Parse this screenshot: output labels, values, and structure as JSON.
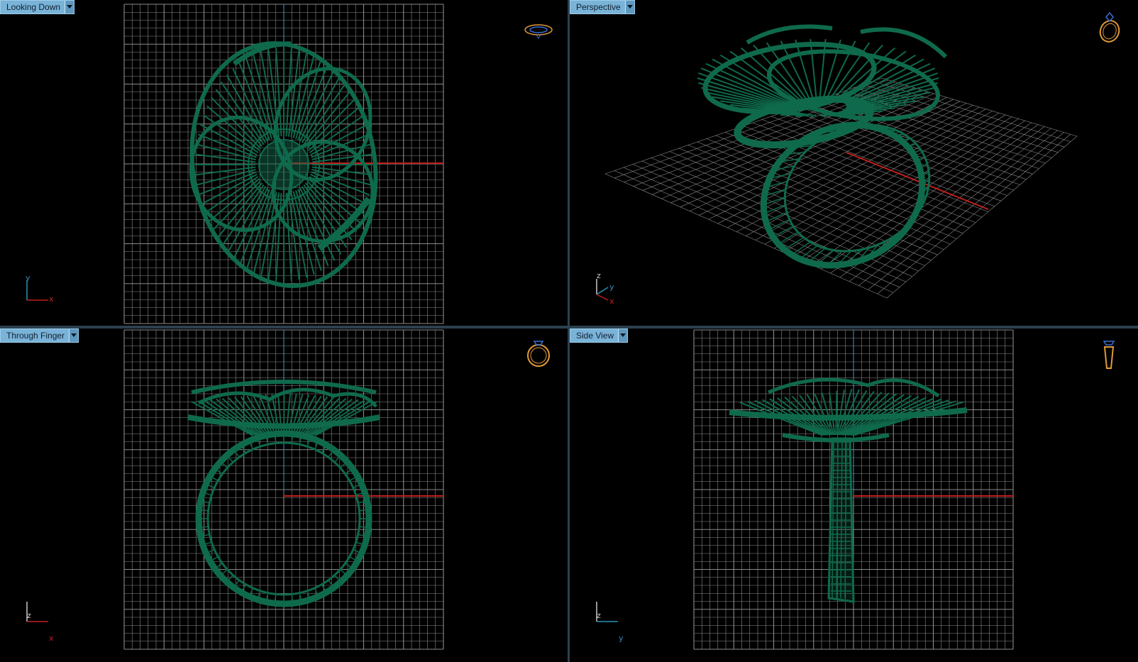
{
  "viewports": {
    "top": {
      "label": "Looking Down",
      "axes": [
        "y",
        "x"
      ]
    },
    "perspective": {
      "label": "Perspective",
      "axes": [
        "z",
        "y",
        "x"
      ]
    },
    "front": {
      "label": "Through Finger",
      "axes": [
        "z",
        "x"
      ]
    },
    "side": {
      "label": "Side View",
      "axes": [
        "z",
        "y"
      ]
    }
  },
  "icons": {
    "dropdown": "chevron-down-icon",
    "nav_top": "ring-top-view-icon",
    "nav_perspective": "ring-perspective-icon",
    "nav_front": "ring-front-view-icon",
    "nav_side": "ring-side-view-icon"
  },
  "colors": {
    "background": "#000000",
    "grid": "#8a8a8a",
    "model": "#0f6a4c",
    "model_highlight": "#2e9a74",
    "axis_x": "#c0201c",
    "axis_y": "#2e8fb8",
    "tab": "#7ab3d8",
    "nav_icon": "#e09a3a"
  }
}
